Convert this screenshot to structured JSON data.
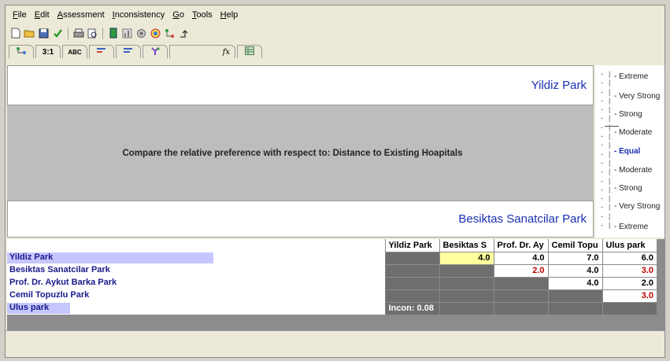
{
  "menubar": {
    "items": [
      {
        "underline": "F",
        "rest": "ile"
      },
      {
        "underline": "E",
        "rest": "dit"
      },
      {
        "underline": "A",
        "rest": "ssessment"
      },
      {
        "underline": "I",
        "rest": "nconsistency"
      },
      {
        "underline": "G",
        "rest": "o"
      },
      {
        "underline": "T",
        "rest": "ools"
      },
      {
        "underline": "H",
        "rest": "elp"
      }
    ]
  },
  "tabs": {
    "tab2": "3:1",
    "tab3": "ABC",
    "fx": "fx"
  },
  "compare": {
    "alt_top": "Yildiz Park",
    "alt_bottom": "Besiktas Sanatcilar Park",
    "prompt": "Compare the relative preference with respect to: Distance to Existing Hoapitals"
  },
  "scale": {
    "labels": [
      "- Extreme",
      "- Very Strong",
      "- Strong",
      "- Moderate",
      "- Equal",
      "- Moderate",
      "- Strong",
      "- Very Strong",
      "- Extreme"
    ],
    "selected_index": 4
  },
  "matrix": {
    "columns": [
      "Yildiz Park",
      "Besiktas S",
      "Prof. Dr. Ay",
      "Cemil Topu",
      "Ulus park"
    ],
    "rows": [
      {
        "name_bold_prefix": "Yildiz Park",
        "name_rest": "",
        "hl": 248
      },
      {
        "name_bold_prefix": "Besikta",
        "name_rest": "s Sanatcilar Park",
        "hl": 0
      },
      {
        "name_bold_prefix": "Prof. Dr. Aykut",
        "name_rest": " Barka Park",
        "hl": 0
      },
      {
        "name_bold_prefix": "Cemil",
        "name_rest": " Topuzlu Park",
        "hl": 0
      },
      {
        "name_bold_prefix": "Ulus park",
        "name_rest": "",
        "hl": 0
      }
    ],
    "values": [
      [
        "",
        "4.0",
        "4.0",
        "7.0",
        "6.0"
      ],
      [
        "",
        "",
        "2.0",
        "4.0",
        "3.0"
      ],
      [
        "",
        "",
        "",
        "4.0",
        "2.0"
      ],
      [
        "",
        "",
        "",
        "",
        "3.0"
      ],
      [
        "",
        "",
        "",
        "",
        ""
      ]
    ],
    "inconsistency": "Incon: 0.08",
    "colors": {
      "grey": "#6e6e6e",
      "red": "#c00000",
      "yellow": "#ffff9e",
      "highlight": "#c6c6ff"
    }
  }
}
